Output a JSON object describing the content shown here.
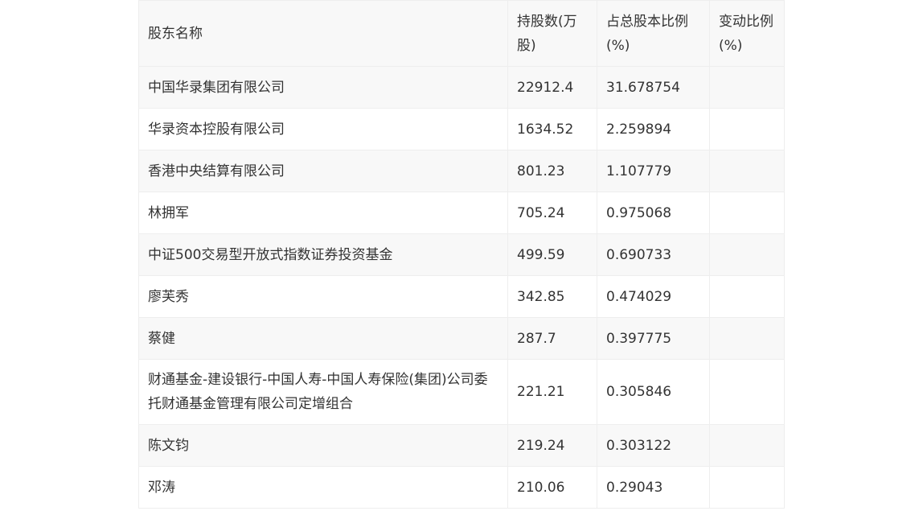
{
  "table": {
    "headers": [
      "股东名称",
      "持股数(万股)",
      "占总股本比例(%)",
      "变动比例(%)"
    ],
    "rows": [
      [
        "中国华录集团有限公司",
        "22912.4",
        "31.678754",
        ""
      ],
      [
        "华录资本控股有限公司",
        "1634.52",
        "2.259894",
        ""
      ],
      [
        "香港中央结算有限公司",
        "801.23",
        "1.107779",
        ""
      ],
      [
        "林拥军",
        "705.24",
        "0.975068",
        ""
      ],
      [
        "中证500交易型开放式指数证券投资基金",
        "499.59",
        "0.690733",
        ""
      ],
      [
        "廖芙秀",
        "342.85",
        "0.474029",
        ""
      ],
      [
        "蔡健",
        "287.7",
        "0.397775",
        ""
      ],
      [
        "财通基金-建设银行-中国人寿-中国人寿保险(集团)公司委托财通基金管理有限公司定增组合",
        "221.21",
        "0.305846",
        ""
      ],
      [
        "陈文钧",
        "219.24",
        "0.303122",
        ""
      ],
      [
        "邓涛",
        "210.06",
        "0.29043",
        ""
      ]
    ]
  }
}
